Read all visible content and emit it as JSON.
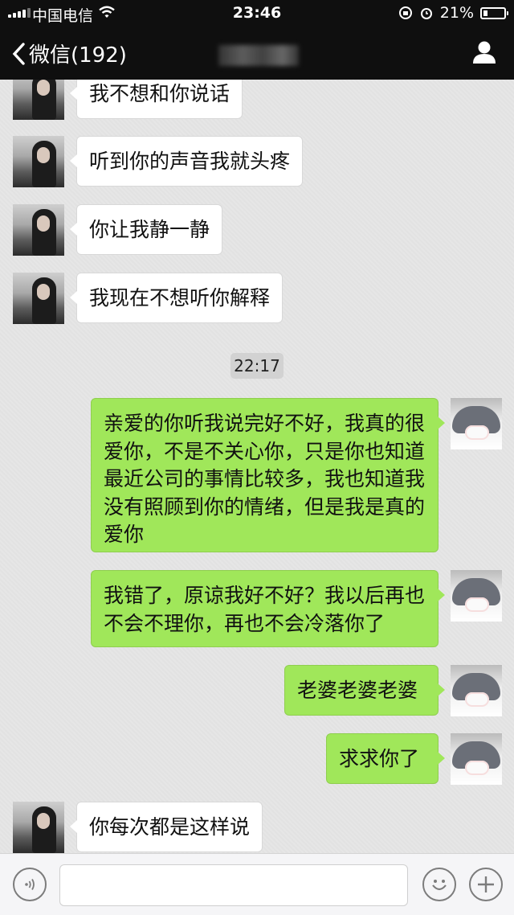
{
  "status_bar": {
    "carrier": "中国电信",
    "time": "23:46",
    "battery": "21%",
    "battery_level": 0.21
  },
  "nav": {
    "back_label": "微信(192)",
    "contact_name_hidden": true
  },
  "messages": [
    {
      "side": "left",
      "text": "我不想和你说话"
    },
    {
      "side": "left",
      "text": "听到你的声音我就头疼"
    },
    {
      "side": "left",
      "text": "你让我静一静"
    },
    {
      "side": "left",
      "text": "我现在不想听你解释"
    },
    {
      "side": "right",
      "text": "亲爱的你听我说完好不好，我真的很爱你，不是不关心你，只是你也知道最近公司的事情比较多，我也知道我没有照顾到你的情绪，但是我是真的爱你"
    },
    {
      "side": "right",
      "text": "我错了，原谅我好不好？我以后再也不会不理你，再也不会冷落你了"
    },
    {
      "side": "right",
      "text": "老婆老婆老婆"
    },
    {
      "side": "right",
      "text": "求求你了"
    },
    {
      "side": "left",
      "text": "你每次都是这样说"
    }
  ],
  "timestamp": "22:17",
  "colors": {
    "header": "#0f0f0f",
    "sent_bubble": "#a0e75a",
    "received_bubble": "#ffffff",
    "chat_bg": "#e6e6e6"
  },
  "icons": {
    "voice": "voice-icon",
    "emoji": "emoji-icon",
    "plus": "plus-icon",
    "profile": "profile-icon",
    "back": "chevron-left-icon"
  }
}
